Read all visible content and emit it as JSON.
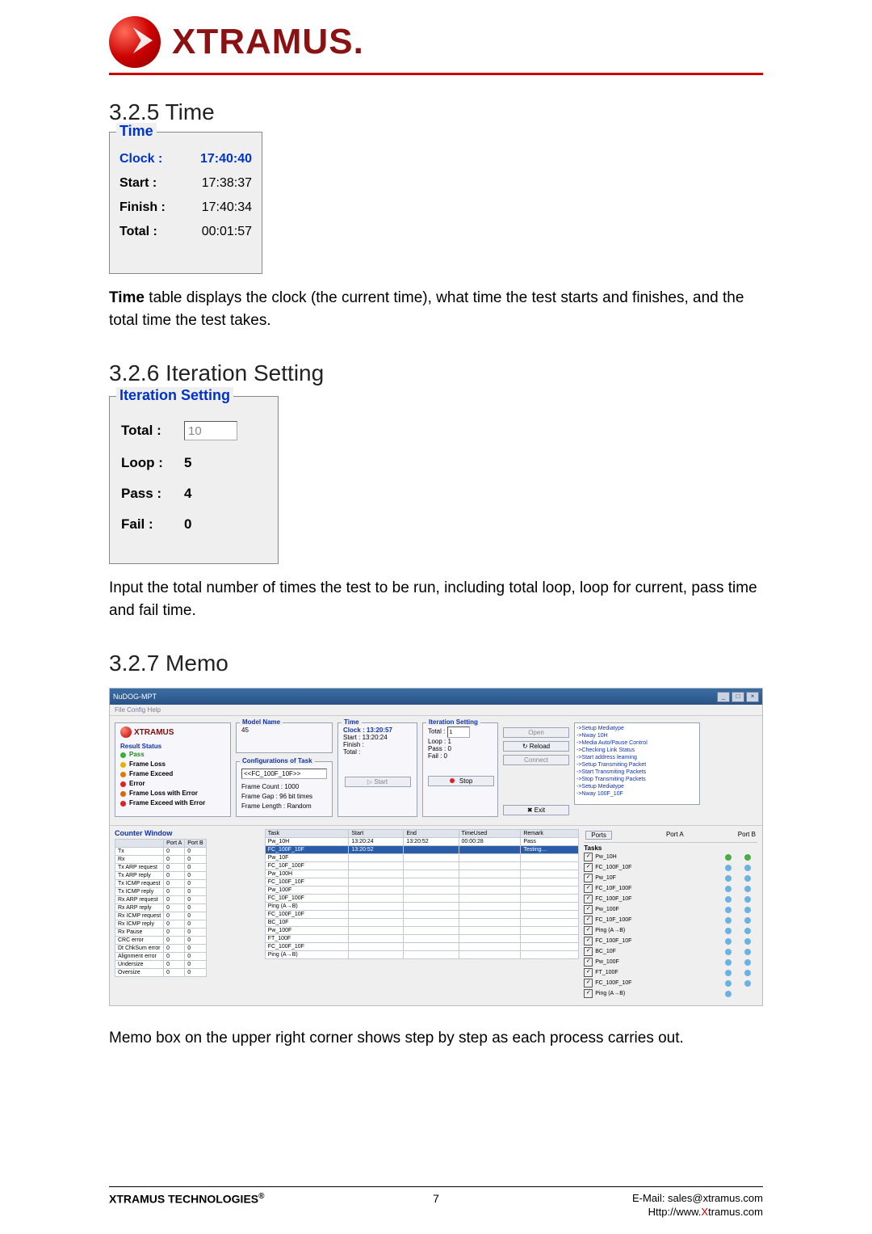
{
  "brand": "XTRAMUS",
  "sections": {
    "time": {
      "heading": "3.2.5 Time",
      "legend": "Time",
      "rows": {
        "clock": {
          "label": "Clock :",
          "value": "17:40:40"
        },
        "start": {
          "label": "Start  :",
          "value": "17:38:37"
        },
        "finish": {
          "label": "Finish :",
          "value": "17:40:34"
        },
        "total": {
          "label": "Total  :",
          "value": "00:01:57"
        }
      },
      "body1": "Time",
      "body2": " table displays the clock (the current time), what time the test starts and finishes, and the total time the test takes."
    },
    "iteration": {
      "heading": "3.2.6 Iteration Setting",
      "legend": "Iteration Setting",
      "rows": {
        "total": {
          "label": "Total :",
          "value": "10"
        },
        "loop": {
          "label": "Loop :",
          "value": "5"
        },
        "pass": {
          "label": "Pass :",
          "value": "4"
        },
        "fail": {
          "label": "Fail :",
          "value": "0"
        }
      },
      "body": "Input the total number of times the test to be run, including total loop, loop for current, pass time and fail time."
    },
    "memo": {
      "heading": "3.2.7 Memo",
      "body": "Memo box on the upper right corner shows step by step as each process carries out."
    }
  },
  "memo_app": {
    "title": "NuDOG-MPT",
    "menus": "File   Config   Help",
    "result_status_title": "Result Status",
    "result_items": [
      "Pass",
      "Frame Loss",
      "Frame Exceed",
      "Error",
      "Frame Loss with Error",
      "Frame Exceed with Error"
    ],
    "model_name_title": "Model Name",
    "model_name": "45",
    "conf_title": "Configurations of Task",
    "conf_task": "<<FC_100F_10F>>",
    "conf_lines": [
      "Frame Count : 1000",
      "Frame Gap : 96 bit times",
      "Frame Length : Random"
    ],
    "time_panel": {
      "title": "Time",
      "clock": "Clock : 13:20:57",
      "start": "Start : 13:20:24",
      "finish": "Finish :",
      "total": "Total :"
    },
    "iter_panel": {
      "title": "Iteration Setting",
      "total_lbl": "Total :",
      "total_val": "1",
      "loop": "Loop :   1",
      "pass": "Pass :   0",
      "fail": "Fail :   0"
    },
    "buttons": {
      "open": "Open",
      "reload": "Reload",
      "connect": "Connect",
      "start": "Start",
      "stop": "Stop",
      "exit": "Exit",
      "ports": "Ports"
    },
    "memo_lines": [
      "->Setup Mediatype",
      "->Nway 10H",
      "->Media Auto/Pause Control",
      "->Checking Link Status",
      "->Start address learning",
      "->Setup Transmiting Packet",
      "->Start Transmiting Packets",
      "->Stop Transmiting Packets",
      "->Setup Mediatype",
      "->Nway 100F_10F"
    ],
    "counter_window_title": "Counter Window",
    "counter_headers": [
      "",
      "Port A",
      "Port B"
    ],
    "counter_rows": [
      "Tx",
      "Rx",
      "Tx ARP request",
      "Tx ARP reply",
      "Tx ICMP request",
      "Tx ICMP reply",
      "Rx ARP request",
      "Rx ARP reply",
      "Rx ICMP request",
      "Rx ICMP reply",
      "Rx Pause",
      "CRC error",
      "Dt ChkSum error",
      "Alignment error",
      "Undersize",
      "Oversize"
    ],
    "tasks_headers": [
      "Task",
      "Start",
      "End",
      "TimeUsed",
      "Remark"
    ],
    "tasks_rows": [
      {
        "name": "Pw_10H",
        "start": "13:20:24",
        "end": "13:20:52",
        "used": "00:00:28",
        "remark": "Pass"
      },
      {
        "name": "FC_100F_10F",
        "start": "13:20:52",
        "end": "",
        "used": "",
        "remark": "Testing…"
      }
    ],
    "tasks_other": [
      "Pw_10F",
      "FC_10F_100F",
      "Pw_100H",
      "FC_100F_10F",
      "Pw_100F",
      "FC_10F_100F",
      "Ping (A→B)",
      "FC_100F_10F",
      "BC_10F",
      "Pw_100F",
      "FT_100F",
      "FC_100F_10F",
      "Ping (A→B)"
    ],
    "ports_headers": [
      "Tasks",
      "Port A",
      "Port B"
    ],
    "port_tasks": [
      "Pw_10H",
      "FC_100F_10F",
      "Pw_10F",
      "FC_10F_100F",
      "FC_100F_10F",
      "Pw_100F",
      "FC_10F_100F",
      "Ping (A→B)",
      "FC_100F_10F",
      "BC_10F",
      "Pw_100F",
      "FT_100F",
      "FC_100F_10F",
      "Ping (A→B)"
    ]
  },
  "footer": {
    "company": "XTRAMUS TECHNOLOGIES",
    "page": "7",
    "email": "E-Mail: sales@xtramus.com",
    "url_pre": "Http://www.",
    "url_x": "X",
    "url_post": "tramus.com"
  }
}
